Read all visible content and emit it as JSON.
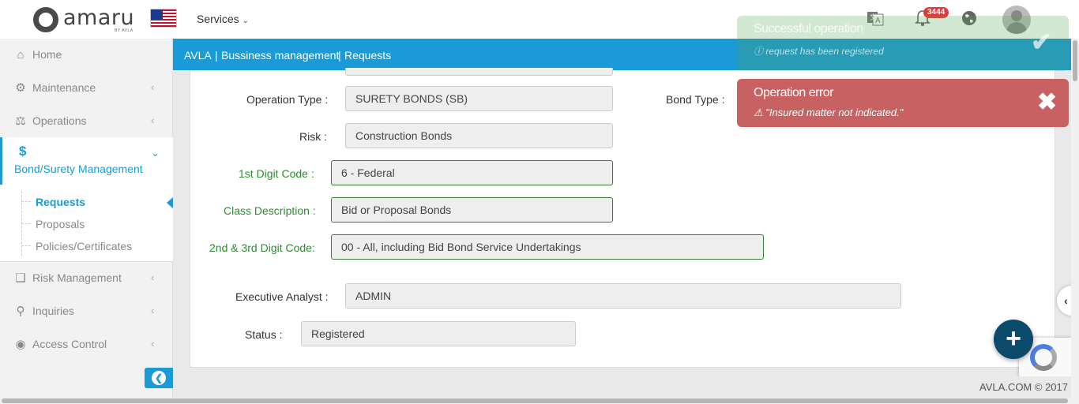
{
  "header": {
    "logo_text": "amaru",
    "logo_sub": "BY AVLA",
    "services_label": "Services",
    "notification_count": "3444"
  },
  "sidebar": {
    "items": [
      {
        "label": "Home",
        "icon": "home-icon"
      },
      {
        "label": "Maintenance",
        "icon": "gear-icon"
      },
      {
        "label": "Operations",
        "icon": "handshake-icon"
      },
      {
        "label": "Bond/Surety Management",
        "icon": "dollar-icon"
      },
      {
        "label": "Risk Management",
        "icon": "cubes-icon"
      },
      {
        "label": "Inquiries",
        "icon": "search-icon"
      },
      {
        "label": "Access Control",
        "icon": "lock-icon"
      }
    ],
    "submenu": [
      {
        "label": "Requests"
      },
      {
        "label": "Proposals"
      },
      {
        "label": "Policies/Certificates"
      }
    ]
  },
  "breadcrumb": {
    "parts": [
      "AVLA",
      "Bussiness management",
      "Requests"
    ],
    "separator": "|"
  },
  "form": {
    "operation_type": {
      "label": "Operation Type :",
      "value": "SURETY BONDS (SB)"
    },
    "bond_type": {
      "label": "Bond Type :"
    },
    "risk": {
      "label": "Risk :",
      "value": "Construction Bonds"
    },
    "first_digit": {
      "label": "1st Digit Code :",
      "value": "6 - Federal"
    },
    "class_description": {
      "label": "Class Description :",
      "value": "Bid or Proposal Bonds"
    },
    "second_third_digit": {
      "label": "2nd & 3rd Digit Code:",
      "value": "00 - All, including Bid Bond Service Undertakings"
    },
    "executive_analyst": {
      "label": "Executive Analyst :",
      "value": "ADMIN"
    },
    "status": {
      "label": "Status :",
      "value": "Registered"
    }
  },
  "toasts": {
    "success": {
      "title": "Successful operation",
      "message": "request has been registered"
    },
    "error": {
      "title": "Operation error",
      "message": "\"Insured matter not indicated.\""
    }
  },
  "footer": {
    "text": "AVLA.COM © 2017"
  },
  "colors": {
    "primary": "#1a9ad6",
    "error": "#c86161",
    "success": "#51a351",
    "valid_field": "#2e8b2e",
    "fab": "#0b4a6b"
  }
}
